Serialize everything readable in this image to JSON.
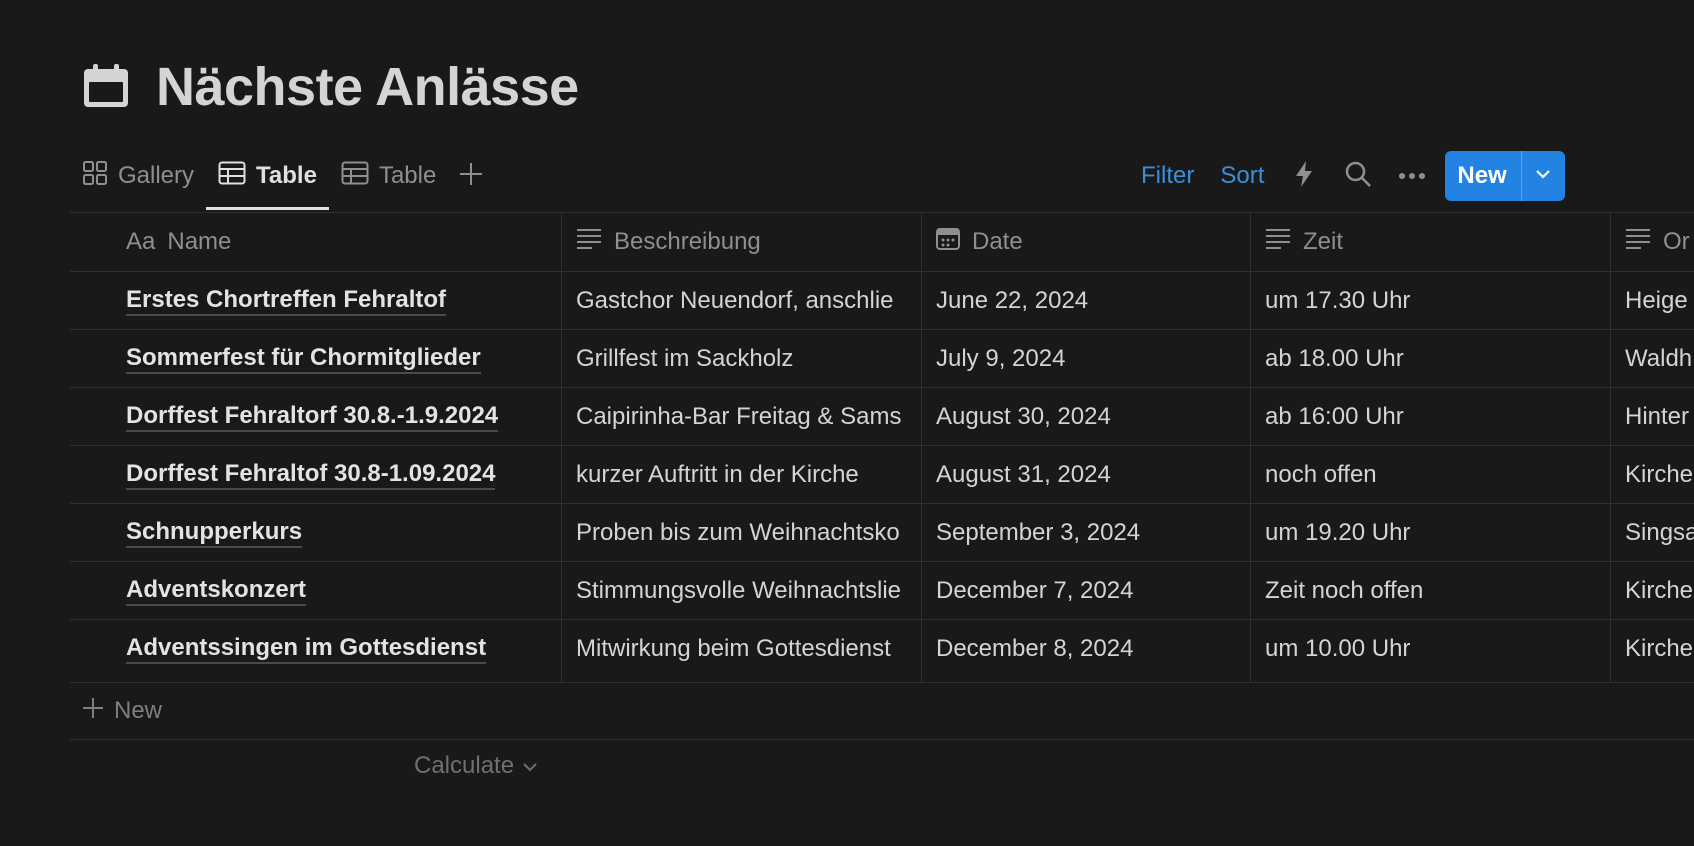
{
  "page": {
    "title": "Nächste Anlässe",
    "icon": "calendar-icon"
  },
  "views": {
    "tabs": [
      {
        "label": "Gallery",
        "icon": "gallery-grid-icon",
        "active": false
      },
      {
        "label": "Table",
        "icon": "table-icon",
        "active": true
      },
      {
        "label": "Table",
        "icon": "table-icon",
        "active": false
      }
    ],
    "add_view_icon": "plus-icon"
  },
  "toolbar": {
    "filter_label": "Filter",
    "sort_label": "Sort",
    "automation_icon": "lightning-icon",
    "search_icon": "search-icon",
    "more_icon": "more-horizontal-icon",
    "new_label": "New",
    "new_dropdown_icon": "chevron-down-icon",
    "accent_color": "#2383e2",
    "link_color": "#3a8fdc"
  },
  "table": {
    "columns": [
      {
        "label": "Name",
        "prefix": "Aa",
        "icon": "title-property-icon"
      },
      {
        "label": "Beschreibung",
        "icon": "text-property-icon"
      },
      {
        "label": "Date",
        "icon": "calendar-property-icon"
      },
      {
        "label": "Zeit",
        "icon": "text-property-icon"
      },
      {
        "label": "Or",
        "icon": "text-property-icon"
      }
    ],
    "rows": [
      {
        "name": "Erstes Chortreffen Fehraltof",
        "beschreibung": "Gastchor Neuendorf, anschlie",
        "date": "June 22, 2024",
        "zeit": "um 17.30 Uhr",
        "ort": "Heige"
      },
      {
        "name": "Sommerfest für Chormitglieder",
        "beschreibung": "Grillfest im Sackholz",
        "date": "July 9, 2024",
        "zeit": "ab 18.00 Uhr",
        "ort": "Waldh"
      },
      {
        "name": "Dorffest Fehraltorf 30.8.-1.9.2024",
        "beschreibung": "Caipirinha-Bar Freitag & Sams",
        "date": "August 30, 2024",
        "zeit": "ab 16:00 Uhr",
        "ort": "Hinter"
      },
      {
        "name": "Dorffest Fehraltof 30.8-1.09.2024",
        "beschreibung": "kurzer Auftritt in der Kirche",
        "date": "August 31, 2024",
        "zeit": "noch offen",
        "ort": "Kirche"
      },
      {
        "name": "Schnupperkurs",
        "beschreibung": "Proben bis zum Weihnachtsko",
        "date": "September 3, 2024",
        "zeit": "um 19.20 Uhr",
        "ort": "Singsa"
      },
      {
        "name": "Adventskonzert",
        "beschreibung": "Stimmungsvolle Weihnachtslie",
        "date": "December 7, 2024",
        "zeit": "Zeit noch offen",
        "ort": "Kirche"
      },
      {
        "name": "Adventssingen im Gottesdienst",
        "beschreibung": "Mitwirkung beim Gottesdienst",
        "date": "December 8, 2024",
        "zeit": "um 10.00 Uhr",
        "ort": "Kirche"
      }
    ],
    "add_row_label": "New",
    "calculate_label": "Calculate"
  }
}
